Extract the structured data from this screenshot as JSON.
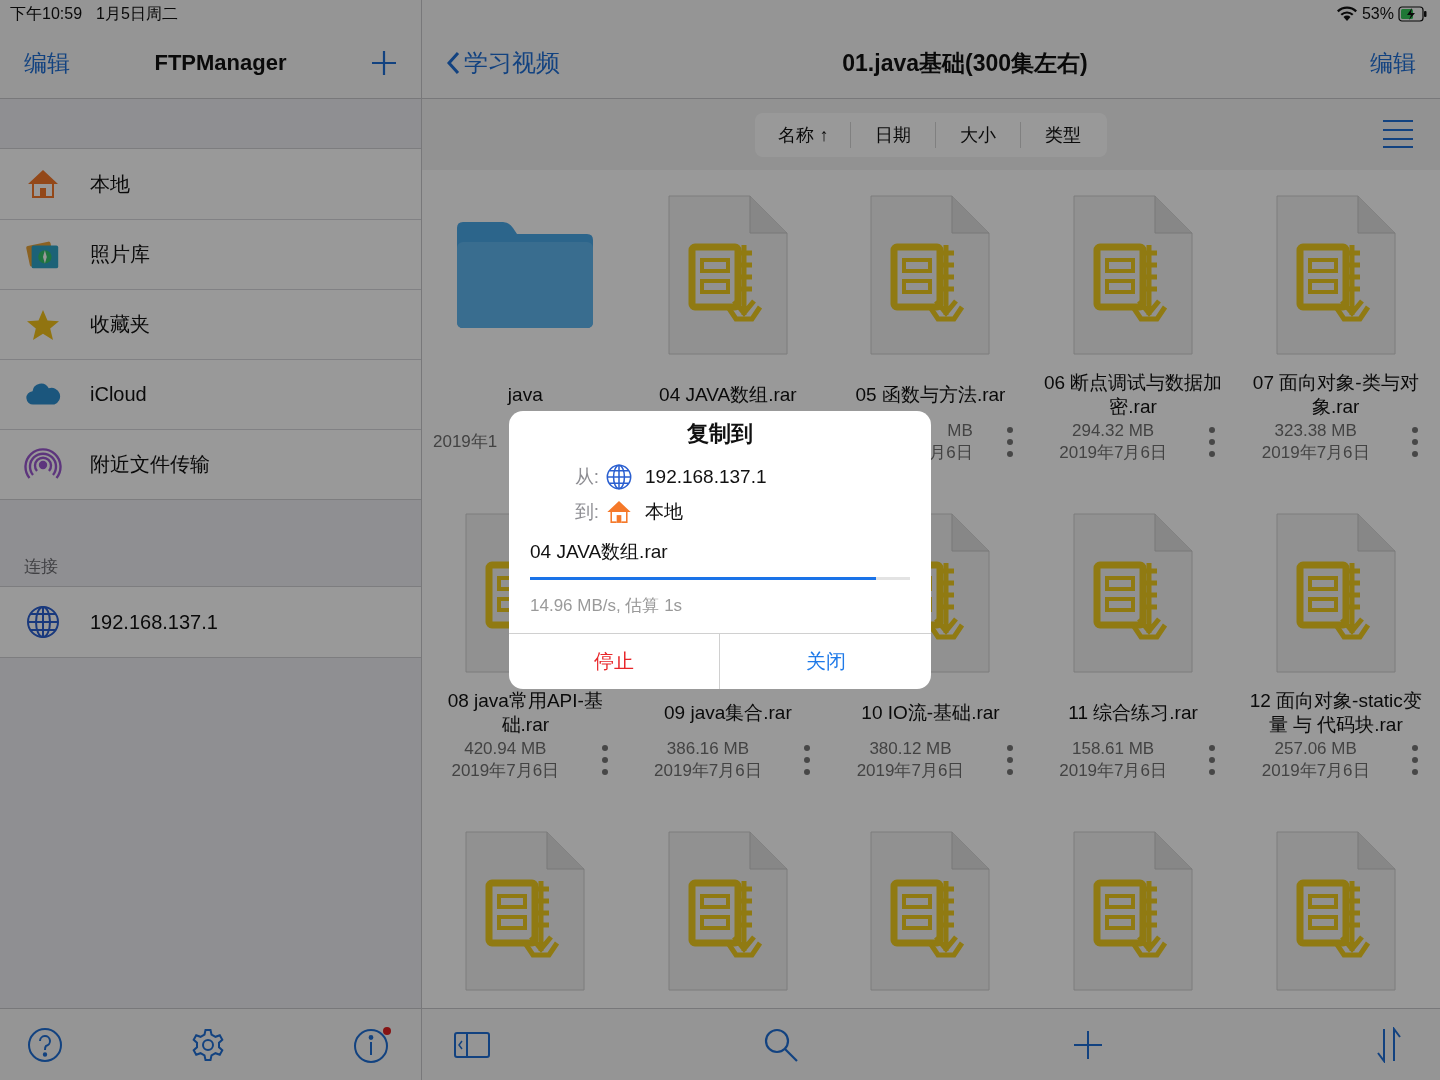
{
  "status_bar": {
    "time": "下午10:59",
    "date": "1月5日周二",
    "battery": "53%"
  },
  "sidebar": {
    "edit": "编辑",
    "title": "FTPManager",
    "items": [
      {
        "kind": "local",
        "label": "本地"
      },
      {
        "kind": "photos",
        "label": "照片库"
      },
      {
        "kind": "favorites",
        "label": "收藏夹"
      },
      {
        "kind": "cloud",
        "label": "iCloud"
      },
      {
        "kind": "nearby",
        "label": "附近文件传输"
      }
    ],
    "section": "连接",
    "connections": [
      {
        "kind": "server",
        "label": "192.168.137.1"
      }
    ]
  },
  "browser": {
    "back": "学习视频",
    "title": "01.java基础(300集左右)",
    "edit": "编辑",
    "sort": [
      "名称 ↑",
      "日期",
      "大小",
      "类型"
    ],
    "files": [
      {
        "kind": "folder",
        "name": "java",
        "date": "2019年1"
      },
      {
        "kind": "archive",
        "name": "04 JAVA数组.rar"
      },
      {
        "kind": "archive",
        "name": "05 函数与方法.rar",
        "size": "MB",
        "date": "月6日",
        "more": true
      },
      {
        "kind": "archive",
        "name": "06 断点调试与数据加密.rar",
        "size": "294.32 MB",
        "date": "2019年7月6日",
        "more": true
      },
      {
        "kind": "archive",
        "name": "07 面向对象-类与对象.rar",
        "size": "323.38 MB",
        "date": "2019年7月6日",
        "more": true
      },
      {
        "kind": "archive",
        "name": "08 java常用API-基础.rar",
        "size": "420.94 MB",
        "date": "2019年7月6日",
        "more": true
      },
      {
        "name": "09 java集合.rar",
        "size": "386.16 MB",
        "date": "2019年7月6日",
        "more": true
      },
      {
        "kind": "archive",
        "name": "10 IO流-基础.rar",
        "size": "380.12 MB",
        "date": "2019年7月6日",
        "more": true
      },
      {
        "kind": "archive",
        "name": "11 综合练习.rar",
        "size": "158.61 MB",
        "date": "2019年7月6日",
        "more": true
      },
      {
        "kind": "archive",
        "name": "12 面向对象-static变量 与 代码块.rar",
        "size": "257.06 MB",
        "date": "2019年7月6日",
        "more": true
      },
      {
        "kind": "archive"
      },
      {
        "kind": "archive"
      },
      {
        "kind": "archive"
      },
      {
        "kind": "archive"
      },
      {
        "kind": "archive"
      }
    ]
  },
  "dialog": {
    "title": "复制到",
    "from_label": "从:",
    "from": "192.168.137.1",
    "to_label": "到:",
    "to": "本地",
    "file": "04 JAVA数组.rar",
    "progress": {
      "level": 0.91
    },
    "speed": "14.96 MB/s, 估算 1s",
    "stop": "停止",
    "close": "关闭"
  }
}
